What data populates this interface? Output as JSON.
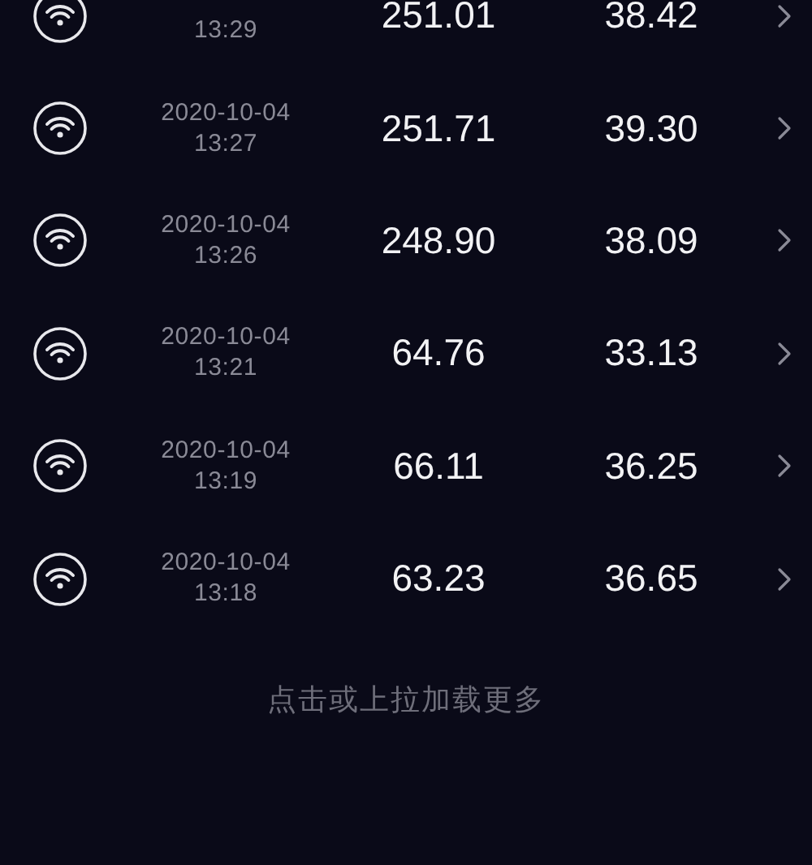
{
  "records": [
    {
      "time": "13:29",
      "download": "251.01",
      "upload": "38.42"
    },
    {
      "date": "2020-10-04",
      "time": "13:27",
      "download": "251.71",
      "upload": "39.30"
    },
    {
      "date": "2020-10-04",
      "time": "13:26",
      "download": "248.90",
      "upload": "38.09"
    },
    {
      "date": "2020-10-04",
      "time": "13:21",
      "download": "64.76",
      "upload": "33.13"
    },
    {
      "date": "2020-10-04",
      "time": "13:19",
      "download": "66.11",
      "upload": "36.25"
    },
    {
      "date": "2020-10-04",
      "time": "13:18",
      "download": "63.23",
      "upload": "36.65"
    }
  ],
  "load_more": "点击或上拉加载更多"
}
